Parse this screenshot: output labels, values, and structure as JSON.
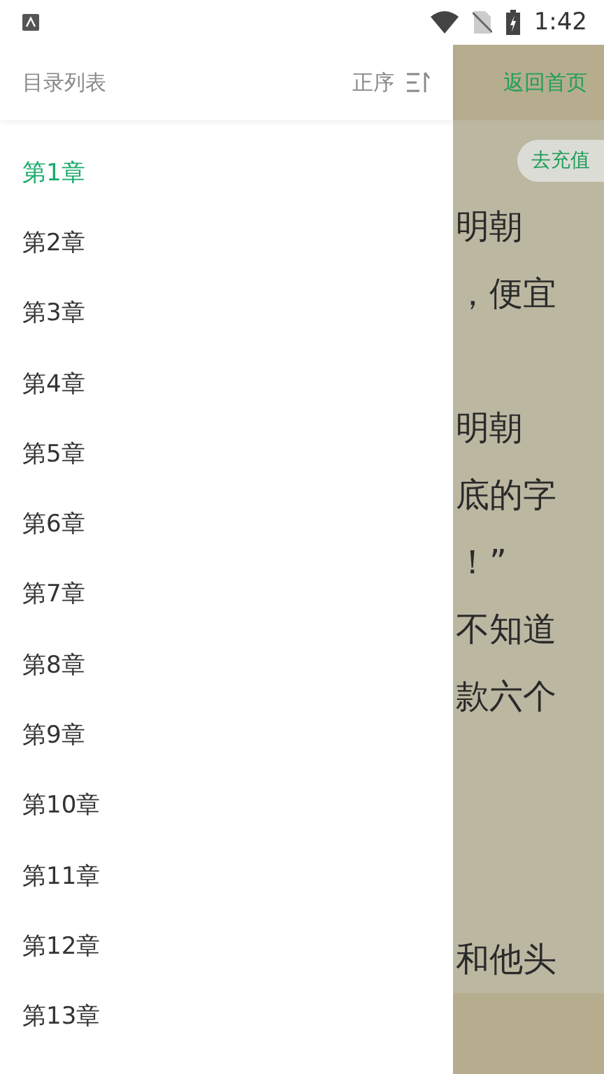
{
  "status_bar": {
    "time": "1:42"
  },
  "drawer": {
    "title": "目录列表",
    "sort_label": "正序",
    "chapters": [
      {
        "label": "第1章",
        "selected": true
      },
      {
        "label": "第2章",
        "selected": false
      },
      {
        "label": "第3章",
        "selected": false
      },
      {
        "label": "第4章",
        "selected": false
      },
      {
        "label": "第5章",
        "selected": false
      },
      {
        "label": "第6章",
        "selected": false
      },
      {
        "label": "第7章",
        "selected": false
      },
      {
        "label": "第8章",
        "selected": false
      },
      {
        "label": "第9章",
        "selected": false
      },
      {
        "label": "第10章",
        "selected": false
      },
      {
        "label": "第11章",
        "selected": false
      },
      {
        "label": "第12章",
        "selected": false
      },
      {
        "label": "第13章",
        "selected": false
      }
    ]
  },
  "reader": {
    "home_link": "返回首页",
    "recharge_button": "去充值",
    "paragraphs": [
      [
        "明朝",
        "，便宜"
      ],
      [
        "明朝",
        "底的字",
        "！”",
        "不知道",
        "款六个"
      ],
      [
        "和他头"
      ]
    ]
  }
}
